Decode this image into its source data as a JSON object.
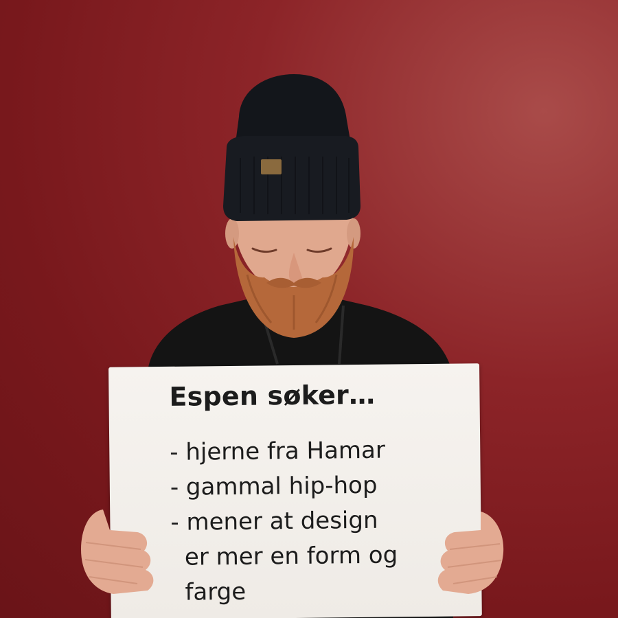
{
  "sign": {
    "title": "Espen søker…",
    "lines": [
      "- hjerne fra Hamar",
      "- gammal hip-hop",
      "- mener at design",
      "er mer en form og",
      "farge"
    ]
  },
  "colors": {
    "wall": "#8c2428",
    "beanie": "#13161b",
    "beard": "#b5683a",
    "sweater": "#141414",
    "sign": "#f3f0ec",
    "text": "#1c1c1c"
  }
}
